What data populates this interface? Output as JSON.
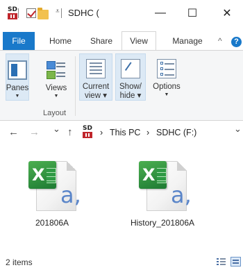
{
  "window": {
    "title": "SDHC (",
    "minimize_glyph": "—",
    "maximize_glyph": "☐",
    "close_glyph": "✕"
  },
  "quick_access": {
    "icon": "sd-card-icon",
    "dropdown_glyph": "⩡"
  },
  "tabs": [
    {
      "label": "File"
    },
    {
      "label": "Home"
    },
    {
      "label": "Share"
    },
    {
      "label": "View"
    },
    {
      "label": "Manage"
    }
  ],
  "ribbon_controls": {
    "collapse_glyph": "^",
    "help_glyph": "?"
  },
  "ribbon": {
    "panes": {
      "label": "Panes",
      "arrow": "▼"
    },
    "views": {
      "label": "Views",
      "arrow": "▼"
    },
    "layout_group": "Layout",
    "current_view": {
      "line1": "Current",
      "line2": "view ▾"
    },
    "show_hide": {
      "line1": "Show/",
      "line2": "hide ▾"
    },
    "options": {
      "label": "Options",
      "arrow": "▼"
    }
  },
  "address": {
    "back": "←",
    "forward": "→",
    "recent": "⌄",
    "up": "↑",
    "sep1": "›",
    "this_pc": "This PC",
    "sep2": "›",
    "drive": "SDHC (F:)",
    "dropdown": "⌄"
  },
  "files": [
    {
      "name": "201806A",
      "type_icon": "excel-icon",
      "ext_letter": "a,"
    },
    {
      "name": "History_201806A",
      "type_icon": "excel-icon",
      "ext_letter": "a,"
    }
  ],
  "file_badge_letter": "X",
  "status": {
    "item_count": "2 items"
  },
  "colors": {
    "accent": "#1979ca",
    "excel_green": "#1d7a33",
    "sd_red": "#c0262c"
  }
}
